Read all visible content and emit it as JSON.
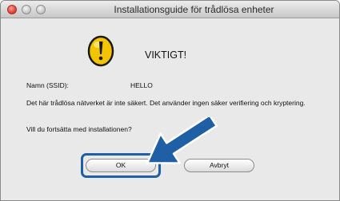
{
  "window": {
    "title": "Installationsguide för trådlösa enheter"
  },
  "dialog": {
    "heading": "VIKTIGT!",
    "ssid_label": "Namn (SSID):",
    "ssid_value": "HELLO",
    "warning": "Det här trådlösa nätverket är inte säkert. Det använder ingen säker verifiering och kryptering.",
    "question": "Vill du fortsätta med installationen?"
  },
  "buttons": {
    "ok_label": "OK",
    "cancel_label": "Avbryt"
  },
  "colors": {
    "accent_blue": "#1f5fa6",
    "warning_yellow": "#f5c400"
  },
  "icons": {
    "alert": "warning-icon",
    "pointer": "arrow-icon"
  }
}
